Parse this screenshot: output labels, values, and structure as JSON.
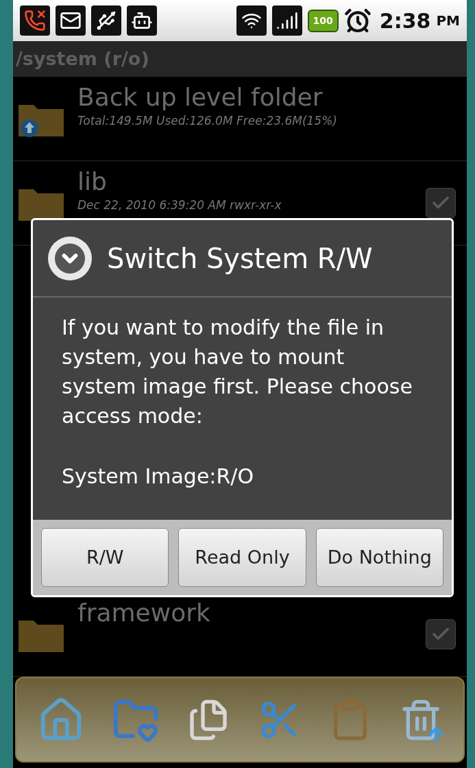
{
  "status_bar": {
    "battery": "100",
    "time": "2:38",
    "period": "PM"
  },
  "path_title": "/system (r/o)",
  "top_rows": [
    {
      "kind": "up",
      "name": "Back up level folder",
      "detail": "Total:149.5M Used:126.0M Free:23.6M(15%)"
    },
    {
      "kind": "folder",
      "name": "lib",
      "detail": "Dec 22, 2010 6:39:20 AM rwxr-xr-x",
      "checked": false
    }
  ],
  "bottom_rows": [
    {
      "name": "framework",
      "checked": false
    }
  ],
  "dialog": {
    "title": "Switch System R/W",
    "message": "If you want to modify the file in system, you have to mount system image first. Please choose access mode:",
    "status": "System Image:R/O",
    "buttons": [
      "R/W",
      "Read Only",
      "Do Nothing"
    ]
  }
}
